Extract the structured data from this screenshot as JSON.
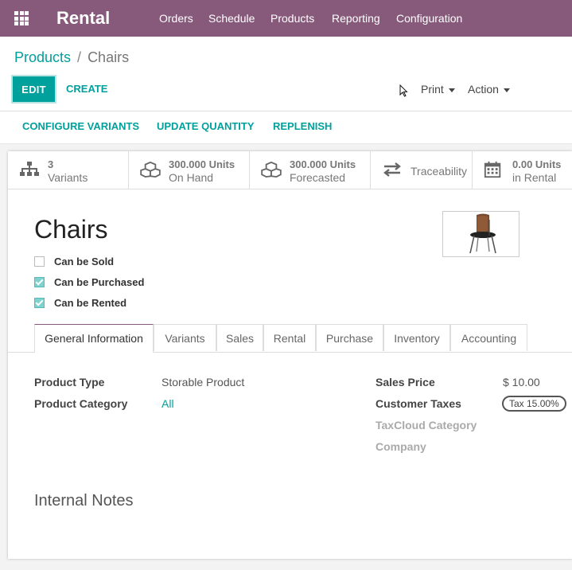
{
  "topbar": {
    "app_title": "Rental",
    "menu": [
      "Orders",
      "Schedule",
      "Products",
      "Reporting",
      "Configuration"
    ]
  },
  "breadcrumb": {
    "parent": "Products",
    "separator": "/",
    "current": "Chairs"
  },
  "toolbar": {
    "edit_label": "EDIT",
    "create_label": "CREATE",
    "print_label": "Print",
    "action_label": "Action"
  },
  "status_buttons": {
    "configure_variants": "CONFIGURE VARIANTS",
    "update_quantity": "UPDATE QUANTITY",
    "replenish": "REPLENISH"
  },
  "smart_buttons": [
    {
      "value": "3",
      "label": "Variants",
      "icon": "sitemap-icon"
    },
    {
      "value": "300.000 Units",
      "label": "On Hand",
      "icon": "cubes-icon"
    },
    {
      "value": "300.000 Units",
      "label": "Forecasted",
      "icon": "cubes-icon"
    },
    {
      "value": "",
      "label": "Traceability",
      "icon": "exchange-icon"
    },
    {
      "value": "0.00 Units",
      "label": "in Rental",
      "icon": "calendar-icon"
    }
  ],
  "product": {
    "name": "Chairs",
    "image_icon": "chair-image",
    "checkboxes": [
      {
        "label": "Can be Sold",
        "checked": false
      },
      {
        "label": "Can be Purchased",
        "checked": true
      },
      {
        "label": "Can be Rented",
        "checked": true
      }
    ]
  },
  "tabs": [
    "General Information",
    "Variants",
    "Sales",
    "Rental",
    "Purchase",
    "Inventory",
    "Accounting"
  ],
  "active_tab": "General Information",
  "fields_left": [
    {
      "label": "Product Type",
      "value": "Storable Product"
    },
    {
      "label": "Product Category",
      "value": "All"
    }
  ],
  "fields_right": [
    {
      "label": "Sales Price",
      "value": "$ 10.00"
    },
    {
      "label": "Customer Taxes",
      "value": "Tax 15.00%"
    },
    {
      "label": "TaxCloud Category",
      "value": ""
    },
    {
      "label": "Company",
      "value": ""
    }
  ],
  "notes_title": "Internal Notes",
  "colors": {
    "brand": "#875a7b",
    "accent": "#00a09d"
  }
}
